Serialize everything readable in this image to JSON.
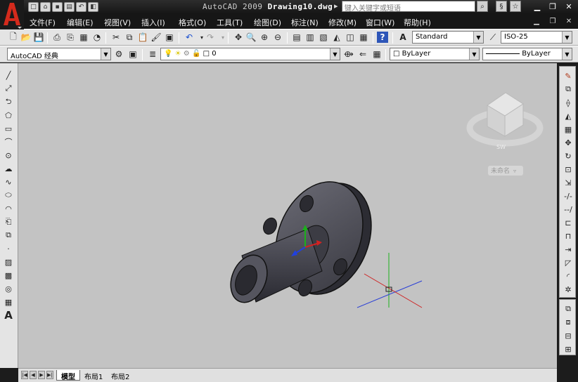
{
  "app_logo": "A",
  "title": {
    "app": "AutoCAD 2009",
    "document": "Drawing10.dwg"
  },
  "search": {
    "placeholder": "键入关键字或短语"
  },
  "menu": [
    "文件(F)",
    "编辑(E)",
    "视图(V)",
    "插入(I)",
    "格式(O)",
    "工具(T)",
    "绘图(D)",
    "标注(N)",
    "修改(M)",
    "窗口(W)",
    "帮助(H)"
  ],
  "toolbar": {
    "text_style": "Standard",
    "dim_style": "ISO-25",
    "workspace": "AutoCAD 经典",
    "layer": "0",
    "color": "ByLayer",
    "linetype": "ByLayer"
  },
  "viewcube": {
    "label": "未命名"
  },
  "tabs": [
    "模型",
    "布局1",
    "布局2"
  ],
  "active_tab": "模型",
  "icons": {
    "logo": "autocad-logo-icon",
    "search": "search-icon",
    "star": "favorites-icon"
  },
  "colors": {
    "canvas": "#c3c3c3",
    "toolbar": "#e4e4e4",
    "frame": "#1c1c1c",
    "logo": "#d42a1c"
  }
}
